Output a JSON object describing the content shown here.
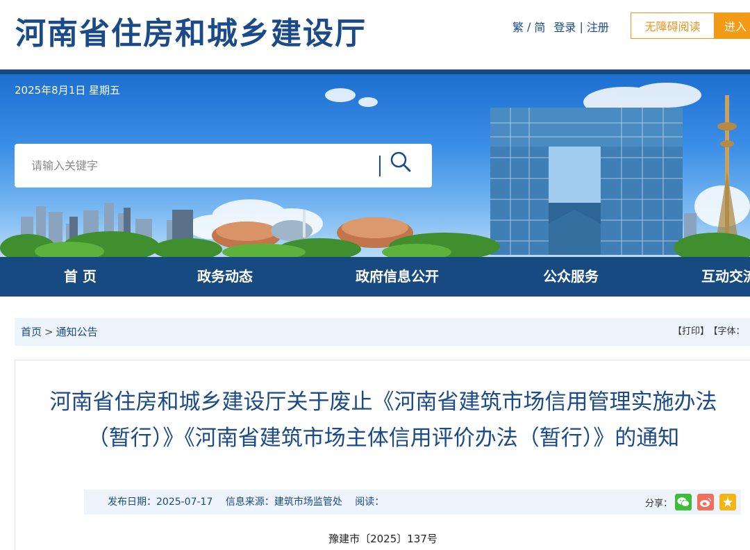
{
  "header": {
    "site_title": "河南省住房和城乡建设厅",
    "lang_trad": "繁",
    "lang_sep": "/",
    "lang_simp": "简",
    "login": "登录",
    "link_sep": "|",
    "register": "注册",
    "accessible_btn": "无障碍阅读",
    "enter_btn": "进入"
  },
  "banner": {
    "date": "2025年8月1日 星期五",
    "search_placeholder": "请输入关键字"
  },
  "nav": {
    "items": [
      {
        "label": "首 页"
      },
      {
        "label": "政务动态"
      },
      {
        "label": "政府信息公开"
      },
      {
        "label": "公众服务"
      },
      {
        "label": "互动交流"
      }
    ]
  },
  "breadcrumb": {
    "home": "首页",
    "arrow": ">",
    "current": "通知公告",
    "print": "【打印】",
    "font": "【字体："
  },
  "article": {
    "title": "河南省住房和城乡建设厅关于废止《河南省建筑市场信用管理实施办法（暂行）》《河南省建筑市场主体信用评价办法（暂行）》的通知",
    "publish_date": "发布日期：2025-07-17",
    "source": "信息来源：建筑市场监管处",
    "views": "阅读：",
    "share_label": "分享：",
    "doc_number": "豫建市〔2025〕137号"
  },
  "colors": {
    "brand_blue": "#164a80",
    "title_blue": "#1a4a87",
    "accent_orange": "#f39a16",
    "light_panel": "#eef4fb"
  },
  "icons": {
    "search": "search-icon",
    "wechat": "wechat-icon",
    "weibo": "weibo-icon",
    "favorite": "star-icon"
  }
}
